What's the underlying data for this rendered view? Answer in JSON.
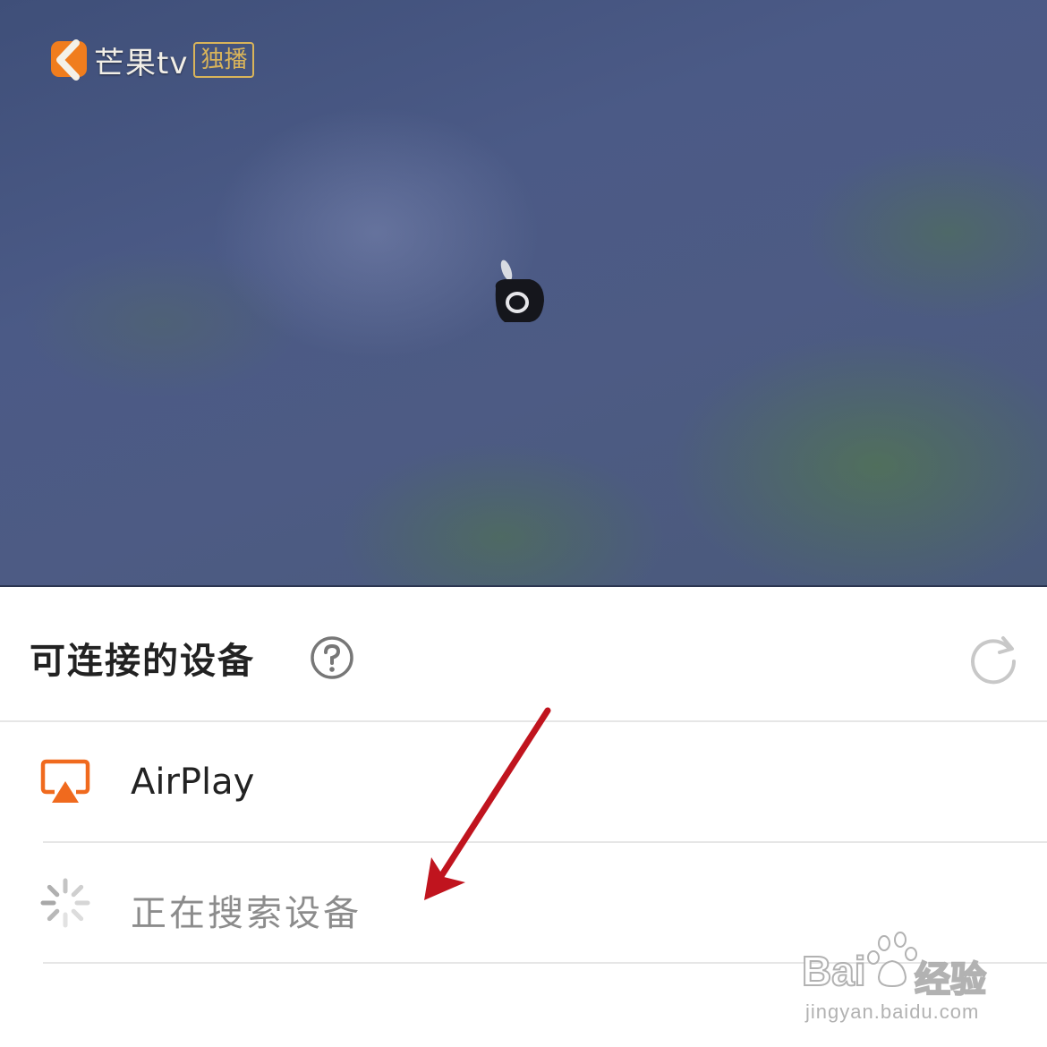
{
  "video": {
    "logo_text": "芒果tv",
    "logo_badge": "独播"
  },
  "sheet": {
    "title": "可连接的设备",
    "items": [
      {
        "label": "AirPlay",
        "icon": "airplay-icon"
      },
      {
        "label": "正在搜索设备",
        "icon": "loading-spinner-icon"
      }
    ]
  },
  "watermark": {
    "brand": "Bai",
    "brand_cn": "经验",
    "url": "jingyan.baidu.com"
  },
  "colors": {
    "accent": "#f06a1e",
    "annotation_arrow": "#c0141e",
    "title_text": "#222222",
    "muted_text": "#8c8c8c"
  }
}
